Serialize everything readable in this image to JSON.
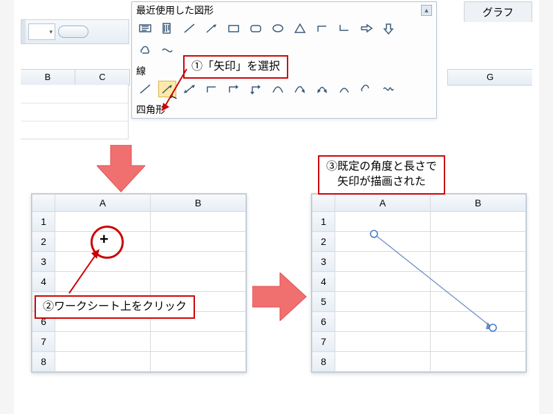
{
  "panel": {
    "header": "最近使用した図形",
    "sections": {
      "lines": "線",
      "rects": "四角形"
    }
  },
  "ribbon": {
    "tab": "グラフ"
  },
  "top_columns": {
    "left": [
      "B",
      "C"
    ],
    "right": "G"
  },
  "callouts": {
    "c1": "①「矢印」を選択",
    "c2": "②ワークシート上をクリック",
    "c3_line1": "③既定の角度と長さで",
    "c3_line2": "矢印が描画された"
  },
  "sheets": {
    "cols": [
      "A",
      "B"
    ],
    "rows": [
      "1",
      "2",
      "3",
      "4",
      "5",
      "6",
      "7",
      "8"
    ]
  },
  "colors": {
    "accent_red": "#cc0000",
    "arrow_fill": "#f07070",
    "select_fill": "#ffe9a8"
  }
}
